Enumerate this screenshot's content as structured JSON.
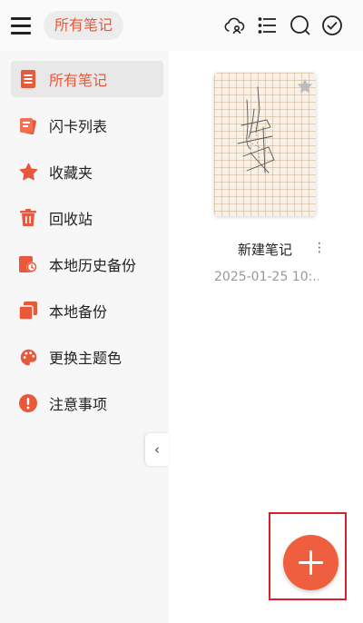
{
  "header": {
    "title": "所有笔记"
  },
  "sidebar": {
    "items": [
      {
        "label": "所有笔记",
        "icon": "notes-icon",
        "active": true
      },
      {
        "label": "闪卡列表",
        "icon": "flashcards-icon",
        "active": false
      },
      {
        "label": "收藏夹",
        "icon": "star-icon",
        "active": false
      },
      {
        "label": "回收站",
        "icon": "trash-icon",
        "active": false
      },
      {
        "label": "本地历史备份",
        "icon": "history-backup-icon",
        "active": false
      },
      {
        "label": "本地备份",
        "icon": "backup-icon",
        "active": false
      },
      {
        "label": "更换主题色",
        "icon": "palette-icon",
        "active": false
      },
      {
        "label": "注意事项",
        "icon": "alert-icon",
        "active": false
      }
    ]
  },
  "notes": [
    {
      "title": "新建笔记",
      "date": "2025-01-25 10:..."
    }
  ],
  "colors": {
    "accent": "#e8593c",
    "fab": "#ef5f3f"
  }
}
